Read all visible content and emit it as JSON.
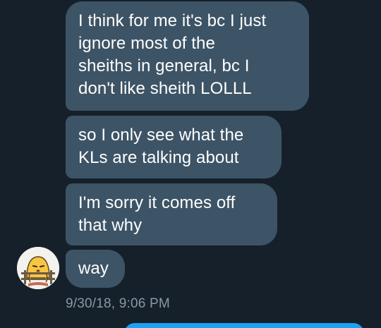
{
  "messages": [
    {
      "lines": [
        "I think for me it's bc I just",
        "ignore most of the",
        "sheiths in general, bc I",
        "don't like sheith LOLLL"
      ]
    },
    {
      "lines": [
        "so I only see what the",
        "KLs are talking about"
      ]
    },
    {
      "lines": [
        "I'm sorry it comes off",
        "that why"
      ]
    },
    {
      "lines": [
        "way"
      ]
    }
  ],
  "timestamp": "9/30/18, 9:06 PM",
  "colors": {
    "background": "#15202b",
    "incoming_bubble": "#3d5466",
    "outgoing_bubble": "#1da1f2",
    "timestamp_text": "#8899a6"
  },
  "avatar_icon": "gudetama-egg-icon"
}
